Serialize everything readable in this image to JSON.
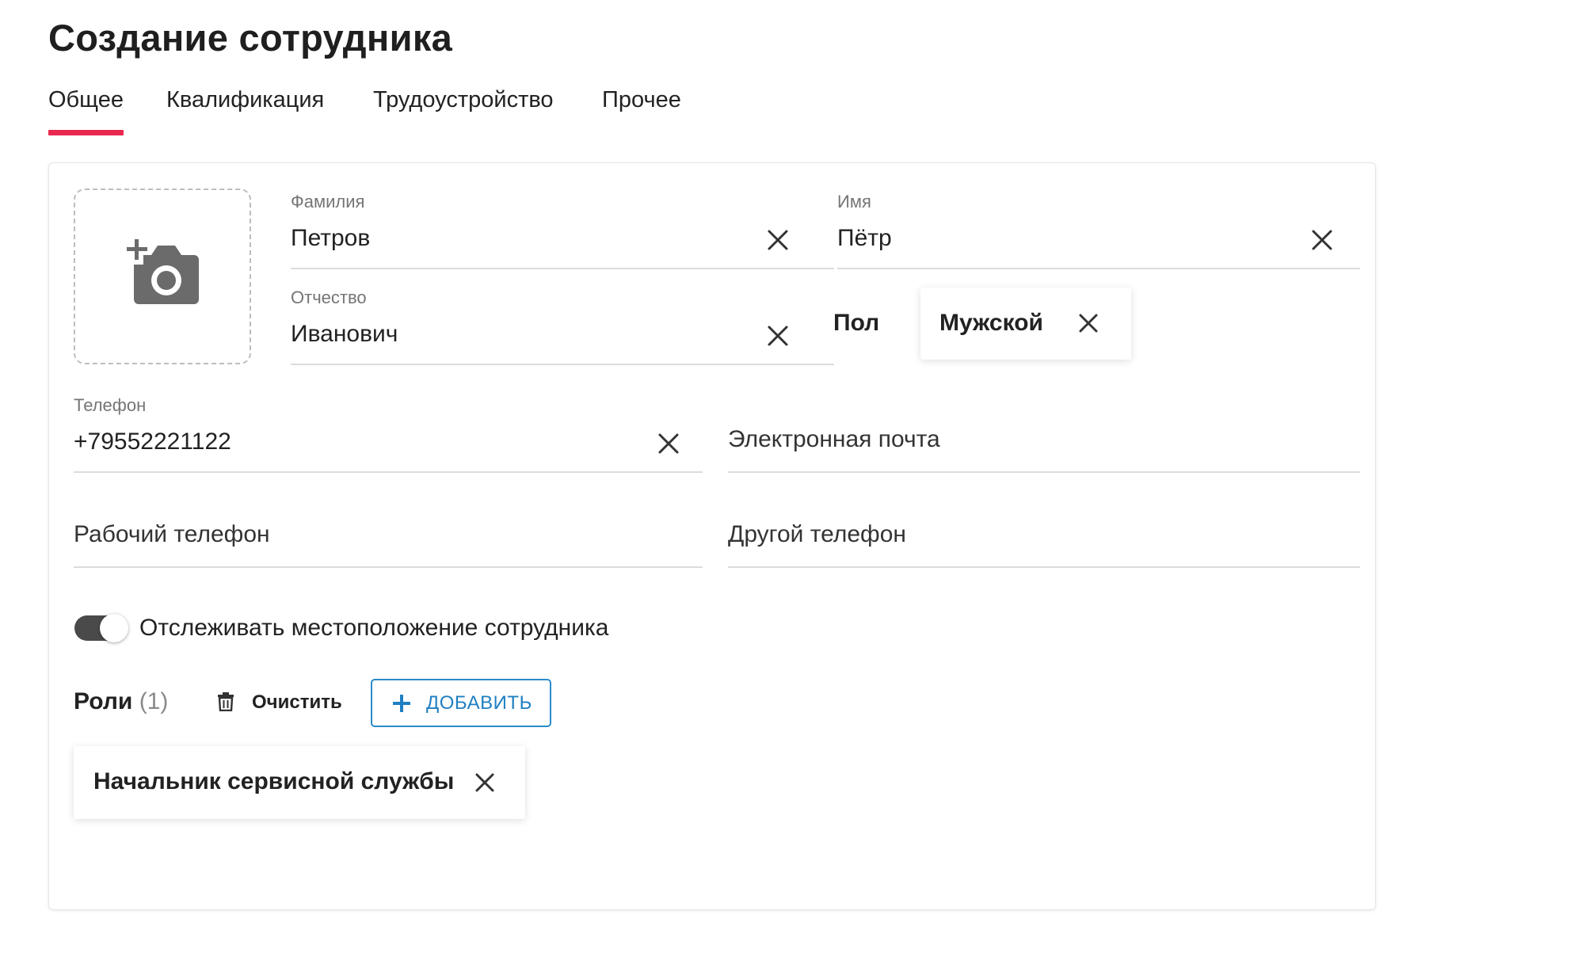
{
  "page": {
    "title": "Создание сотрудника"
  },
  "tabs": [
    {
      "label": "Общее",
      "active": true
    },
    {
      "label": "Квалификация",
      "active": false
    },
    {
      "label": "Трудоустройство",
      "active": false
    },
    {
      "label": "Прочее",
      "active": false
    }
  ],
  "form": {
    "photo": {
      "icon": "add-photo-camera-icon"
    },
    "last_name": {
      "label": "Фамилия",
      "value": "Петров"
    },
    "first_name": {
      "label": "Имя",
      "value": "Пётр"
    },
    "middle_name": {
      "label": "Отчество",
      "value": "Иванович"
    },
    "gender": {
      "label": "Пол",
      "value": "Мужской"
    },
    "phone": {
      "label": "Телефон",
      "value": "+79552221122"
    },
    "email": {
      "placeholder": "Электронная почта"
    },
    "work_phone": {
      "placeholder": "Рабочий телефон"
    },
    "other_phone": {
      "placeholder": "Другой телефон"
    },
    "track_location": {
      "label": "Отслеживать местоположение сотрудника",
      "enabled": true
    }
  },
  "roles": {
    "title": "Роли",
    "count": "(1)",
    "clear_label": "Очистить",
    "add_label": "ДОБАВИТЬ",
    "items": [
      "Начальник сервисной службы"
    ]
  },
  "colors": {
    "accent": "#e8284f",
    "button_blue": "#1f7fc2",
    "toggle_on": "#4a4a4a"
  }
}
